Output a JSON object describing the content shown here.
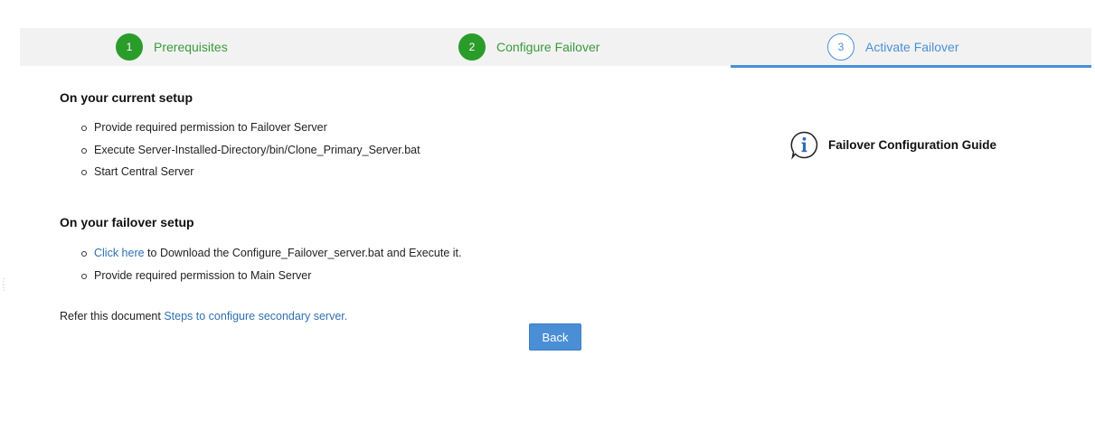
{
  "stepper": {
    "steps": [
      {
        "number": "1",
        "label": "Prerequisites",
        "state": "done"
      },
      {
        "number": "2",
        "label": "Configure Failover",
        "state": "done"
      },
      {
        "number": "3",
        "label": "Activate Failover",
        "state": "active"
      }
    ]
  },
  "current_setup": {
    "title": "On your current setup",
    "items": [
      "Provide required permission to Failover Server",
      "Execute Server-Installed-Directory/bin/Clone_Primary_Server.bat",
      "Start Central Server"
    ]
  },
  "failover_setup": {
    "title": "On your failover setup",
    "click_here_link": "Click here",
    "click_here_rest": " to Download the Configure_Failover_server.bat and Execute it.",
    "item_2": "Provide required permission to Main Server"
  },
  "refer": {
    "prefix": "Refer this document ",
    "link": "Steps to configure secondary server."
  },
  "back_button": "Back",
  "guide": {
    "label": "Failover Configuration Guide",
    "icon": "info-icon"
  },
  "colors": {
    "done_green": "#2a9c2a",
    "active_blue": "#4a8fd6",
    "link_blue": "#2f6fb0"
  }
}
